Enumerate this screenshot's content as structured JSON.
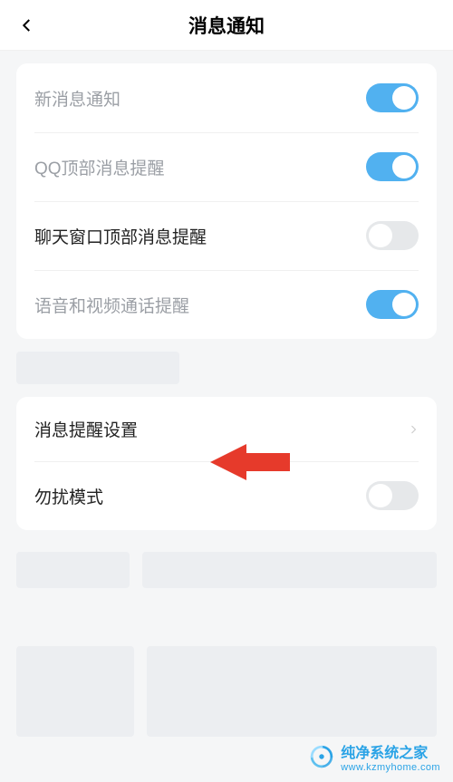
{
  "header": {
    "title": "消息通知"
  },
  "group1": {
    "items": [
      {
        "label": "新消息通知",
        "state": "on",
        "muted": true
      },
      {
        "label": "QQ顶部消息提醒",
        "state": "on",
        "muted": true
      },
      {
        "label": "聊天窗口顶部消息提醒",
        "state": "off",
        "muted": false
      },
      {
        "label": "语音和视频通话提醒",
        "state": "on",
        "muted": true
      }
    ]
  },
  "group2": {
    "link": {
      "label": "消息提醒设置"
    },
    "dnd": {
      "label": "勿扰模式",
      "state": "off"
    }
  },
  "footer": {
    "brand": "纯净系统之家",
    "url": "www.kzmyhome.com"
  },
  "colors": {
    "toggle_on": "#51b1f0",
    "toggle_off": "#e6e8ea",
    "arrow": "#e63a2b",
    "accent": "#2aa3e6"
  }
}
